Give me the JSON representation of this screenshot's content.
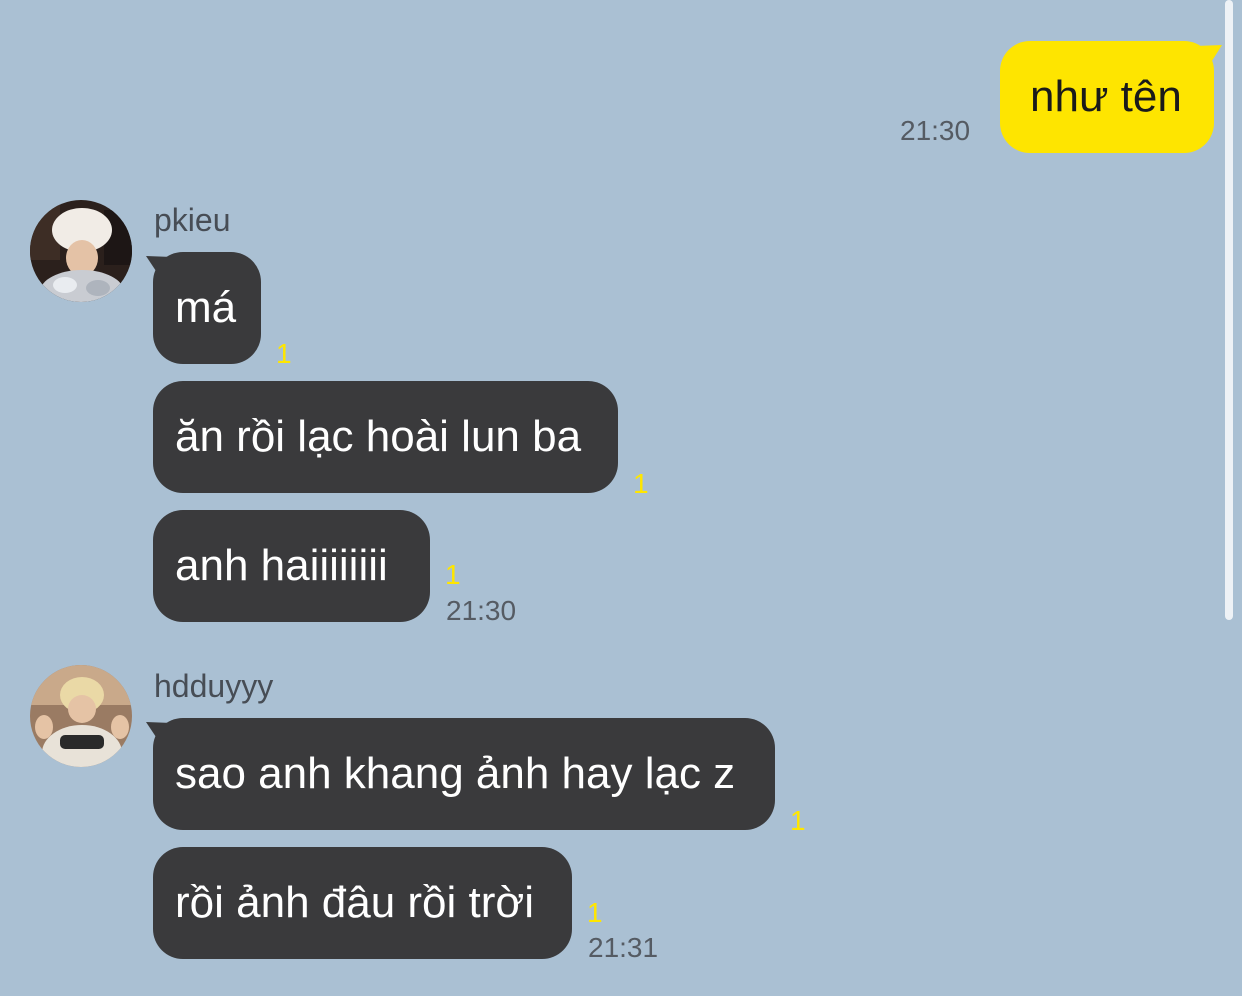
{
  "colors": {
    "background": "#aac0d3",
    "my_bubble": "#fee500",
    "their_bubble": "#3a3a3c",
    "unread": "#ffe600"
  },
  "outgoing": {
    "text": "như tên",
    "time": "21:30"
  },
  "groups": [
    {
      "sender": "pkieu",
      "avatar_icon": "avatar-photo-white-fur-hat",
      "messages": [
        {
          "text": "má",
          "unread": "1"
        },
        {
          "text": "ăn rồi lạc hoài lun ba",
          "unread": "1"
        },
        {
          "text": "anh haiiiiiiii",
          "unread": "1"
        }
      ],
      "time": "21:30"
    },
    {
      "sender": "hdduyyy",
      "avatar_icon": "avatar-photo-blonde-hair",
      "messages": [
        {
          "text": "sao anh khang ảnh hay lạc z",
          "unread": "1"
        },
        {
          "text": "rồi ảnh đâu rồi trời",
          "unread": "1"
        }
      ],
      "time": "21:31"
    }
  ]
}
